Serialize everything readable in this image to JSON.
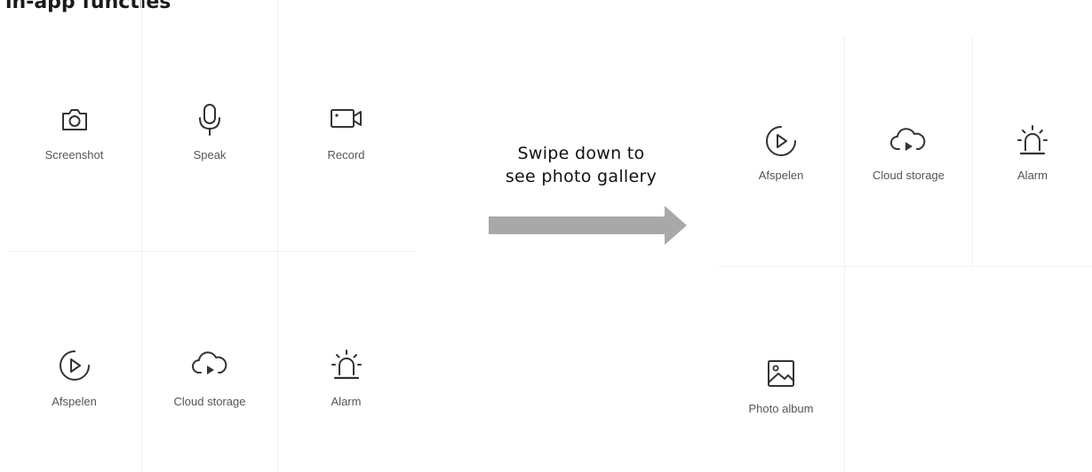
{
  "heading": "in-app functies",
  "left_panel": {
    "tiles": [
      {
        "label": "Screenshot",
        "icon": "camera-icon"
      },
      {
        "label": "Speak",
        "icon": "microphone-icon"
      },
      {
        "label": "Record",
        "icon": "video-camera-icon"
      },
      {
        "label": "Afspelen",
        "icon": "playback-icon"
      },
      {
        "label": "Cloud storage",
        "icon": "cloud-play-icon"
      },
      {
        "label": "Alarm",
        "icon": "siren-icon"
      }
    ]
  },
  "swipe_hint": {
    "line1": "Swipe down to",
    "line2": "see photo gallery"
  },
  "right_panel": {
    "tiles": [
      {
        "label": "Afspelen",
        "icon": "playback-icon"
      },
      {
        "label": "Cloud storage",
        "icon": "cloud-play-icon"
      },
      {
        "label": "Alarm",
        "icon": "siren-icon"
      },
      {
        "label": "Photo album",
        "icon": "photo-icon"
      }
    ]
  },
  "colors": {
    "icon": "#333333",
    "label": "#555555",
    "arrow": "#a8a8a8",
    "divider": "#f0f0f0"
  }
}
